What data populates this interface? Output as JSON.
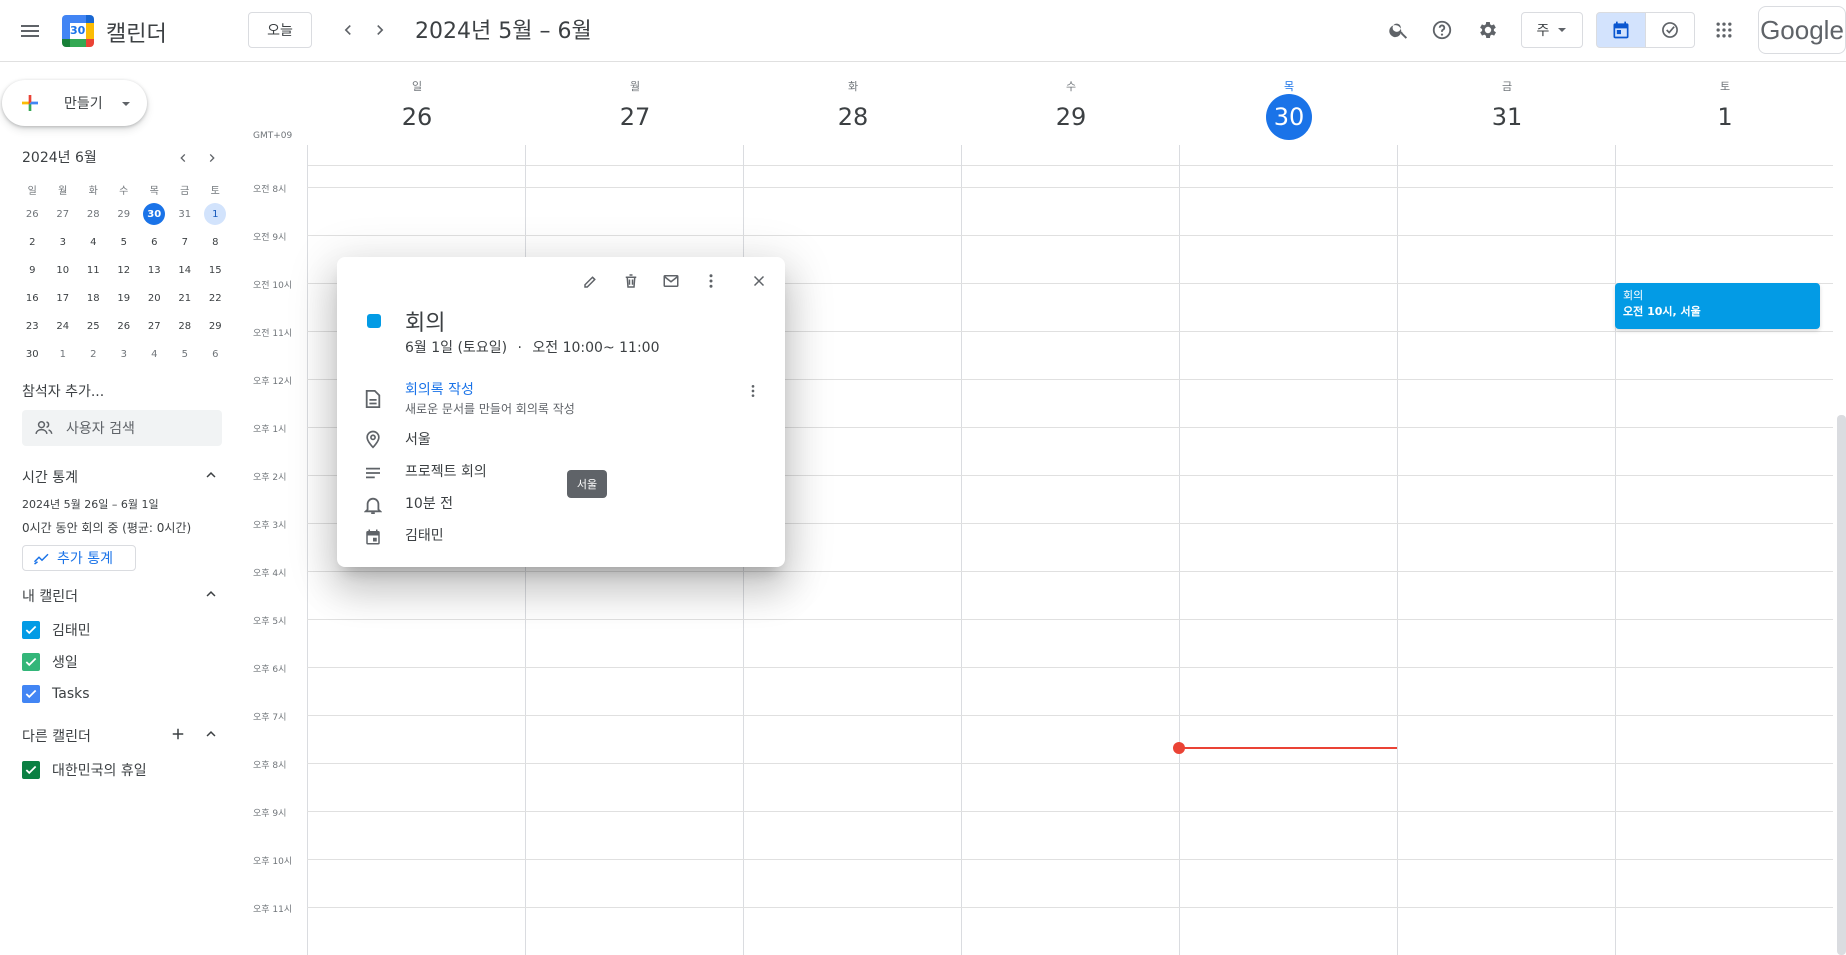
{
  "header": {
    "brand": "캘린더",
    "logo_day": "30",
    "today_button": "오늘",
    "period": "2024년 5월 – 6월",
    "view_select": "주",
    "google_mark": "Google"
  },
  "sidebar": {
    "create_label": "만들기",
    "mini_calendar": {
      "title": "2024년 6월",
      "weekdays": [
        "일",
        "월",
        "화",
        "수",
        "목",
        "금",
        "토"
      ],
      "weeks": [
        [
          "26",
          "27",
          "28",
          "29",
          "30",
          "31",
          "1"
        ],
        [
          "2",
          "3",
          "4",
          "5",
          "6",
          "7",
          "8"
        ],
        [
          "9",
          "10",
          "11",
          "12",
          "13",
          "14",
          "15"
        ],
        [
          "16",
          "17",
          "18",
          "19",
          "20",
          "21",
          "22"
        ],
        [
          "23",
          "24",
          "25",
          "26",
          "27",
          "28",
          "29"
        ],
        [
          "30",
          "1",
          "2",
          "3",
          "4",
          "5",
          "6"
        ]
      ]
    },
    "people_section": "참석자 추가...",
    "people_search_placeholder": "사용자 검색",
    "time_insights": {
      "title": "시간 통계",
      "range": "2024년 5월 26일 – 6월 1일",
      "summary": "0시간 동안 회의 중 (평균: 0시간)",
      "more_button": "추가 통계"
    },
    "my_calendars": {
      "title": "내 캘린더",
      "items": [
        {
          "label": "김태민",
          "color": "#039be5"
        },
        {
          "label": "생일",
          "color": "#33b679"
        },
        {
          "label": "Tasks",
          "color": "#4285f4"
        }
      ]
    },
    "other_calendars": {
      "title": "다른 캘린더",
      "items": [
        {
          "label": "대한민국의 휴일",
          "color": "#0b8043"
        }
      ]
    }
  },
  "week": {
    "timezone": "GMT+09",
    "days": [
      {
        "dow": "일",
        "num": "26"
      },
      {
        "dow": "월",
        "num": "27"
      },
      {
        "dow": "화",
        "num": "28"
      },
      {
        "dow": "수",
        "num": "29"
      },
      {
        "dow": "목",
        "num": "30"
      },
      {
        "dow": "금",
        "num": "31"
      },
      {
        "dow": "토",
        "num": "1"
      }
    ],
    "hours": [
      "오전 8시",
      "오전 9시",
      "오전 10시",
      "오전 11시",
      "오후 12시",
      "오후 1시",
      "오후 2시",
      "오후 3시",
      "오후 4시",
      "오후 5시",
      "오후 6시",
      "오후 7시",
      "오후 8시",
      "오후 9시",
      "오후 10시",
      "오후 11시"
    ],
    "event": {
      "title": "회의",
      "subtitle": "오전 10시, 서울"
    }
  },
  "popup": {
    "title": "회의",
    "date": "6월 1일 (토요일)",
    "separator": "·",
    "time": "오전 10:00~ 11:00",
    "notes_link": "회의록 작성",
    "notes_hint": "새로운 문서를 만들어 회의록 작성",
    "location": "서울",
    "description": "프로젝트 회의",
    "reminder": "10분 전",
    "owner": "김태민",
    "color": "#039be5"
  },
  "tooltip": "서울",
  "colors": {
    "accent": "#1a73e8",
    "now": "#ea4335",
    "event": "#039be5"
  }
}
